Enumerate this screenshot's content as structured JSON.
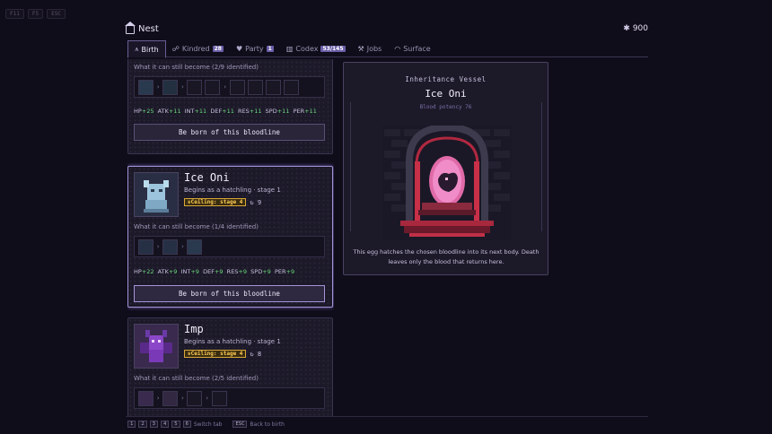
{
  "top_keys": [
    "F11",
    "F5",
    "ESC"
  ],
  "header": {
    "title": "Nest",
    "currency_icon": "gear-icon",
    "currency": "900"
  },
  "tabs": [
    {
      "label": "Birth",
      "icon": "birth-icon",
      "badge": ""
    },
    {
      "label": "Kindred",
      "icon": "kindred-icon",
      "badge": "28"
    },
    {
      "label": "Party",
      "icon": "party-icon",
      "badge": "1"
    },
    {
      "label": "Codex",
      "icon": "codex-icon",
      "badge": "53/145"
    },
    {
      "label": "Jobs",
      "icon": "jobs-icon",
      "badge": ""
    },
    {
      "label": "Surface",
      "icon": "surface-icon",
      "badge": ""
    }
  ],
  "cards": [
    {
      "name": "",
      "what_label": "What it can still become (2/9 identified)",
      "stats": [
        {
          "k": "HP",
          "v": "+25"
        },
        {
          "k": "ATK",
          "v": "+11"
        },
        {
          "k": "INT",
          "v": "+11"
        },
        {
          "k": "DEF",
          "v": "+11"
        },
        {
          "k": "RES",
          "v": "+11"
        },
        {
          "k": "SPD",
          "v": "+11"
        },
        {
          "k": "PER",
          "v": "+11"
        }
      ],
      "button": "Be born of this bloodline"
    },
    {
      "name": "Ice Oni",
      "subtitle": "Begins as a hatchling · stage 1",
      "ceiling": "Ceiling: stage 4",
      "cycles": "9",
      "what_label": "What it can still become (1/4 identified)",
      "stats": [
        {
          "k": "HP",
          "v": "+22"
        },
        {
          "k": "ATK",
          "v": "+9"
        },
        {
          "k": "INT",
          "v": "+9"
        },
        {
          "k": "DEF",
          "v": "+9"
        },
        {
          "k": "RES",
          "v": "+9"
        },
        {
          "k": "SPD",
          "v": "+9"
        },
        {
          "k": "PER",
          "v": "+9"
        }
      ],
      "button": "Be born of this bloodline"
    },
    {
      "name": "Imp",
      "subtitle": "Begins as a hatchling · stage 1",
      "ceiling": "Ceiling: stage 4",
      "cycles": "8",
      "what_label": "What it can still become (2/5 identified)"
    }
  ],
  "vessel": {
    "label": "Inheritance Vessel",
    "name": "Ice Oni",
    "potency": "Blood potency 76",
    "description": "This egg hatches the chosen bloodline into its next body. Death leaves only the blood that returns here."
  },
  "footer": {
    "keys": [
      "1",
      "2",
      "3",
      "4",
      "5",
      "6"
    ],
    "switch_label": "Switch tab",
    "esc_key": "ESC",
    "back_label": "Back to birth"
  }
}
